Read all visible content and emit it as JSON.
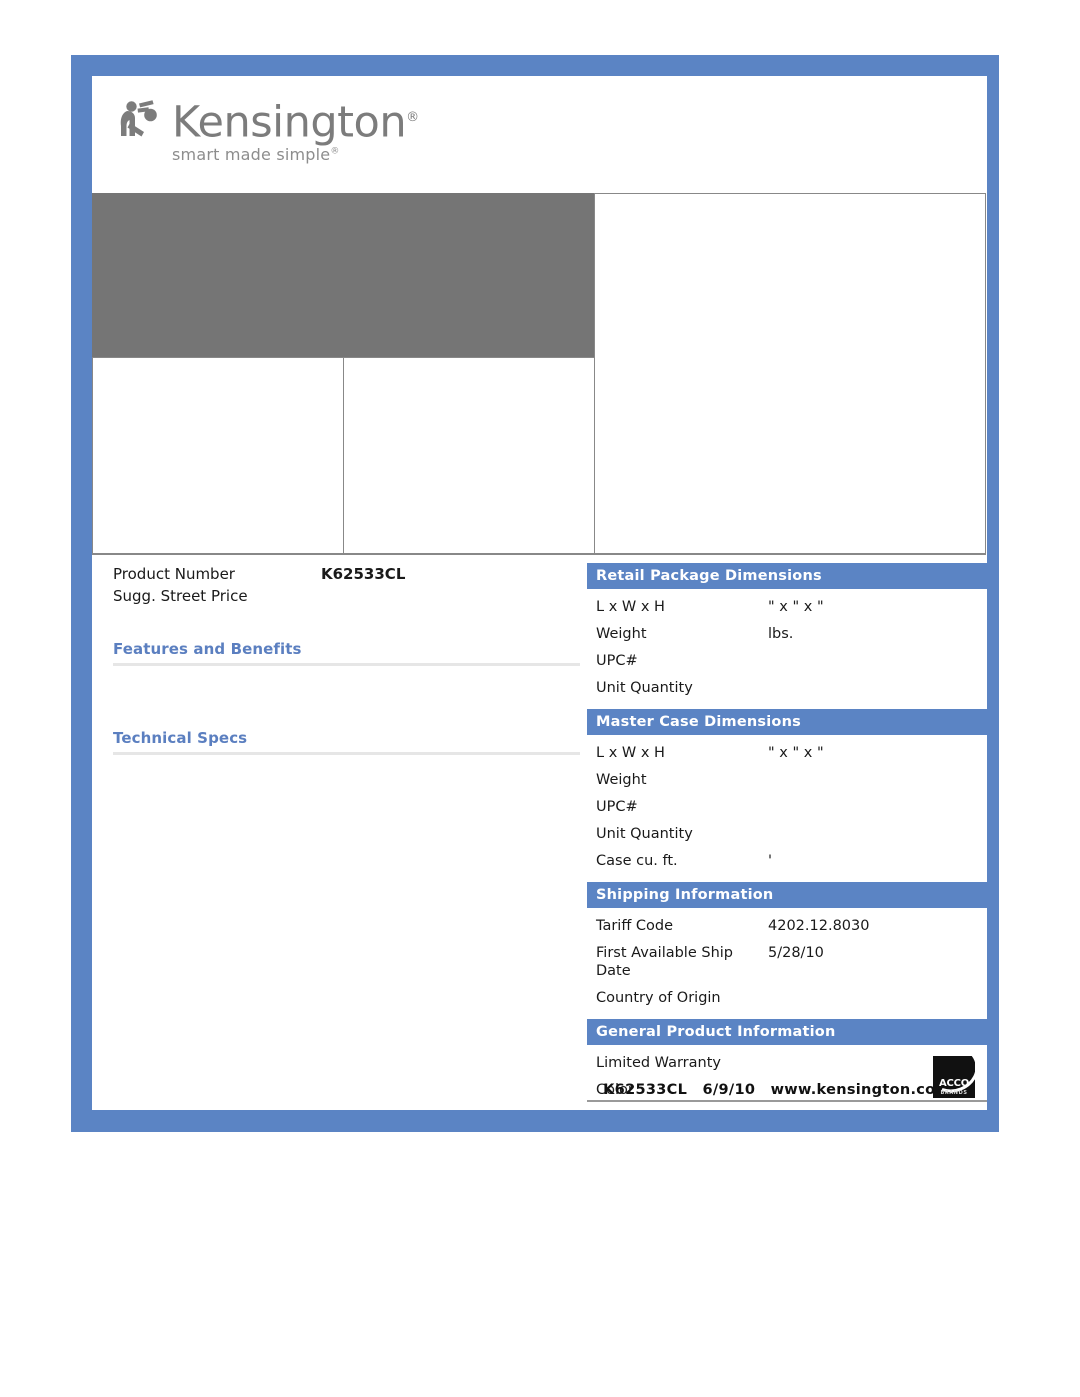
{
  "brand": {
    "name": "Kensington",
    "registered": "®",
    "tagline": "smart made simple",
    "tagline_mark": "®",
    "logo_icon": "kensington-figure-icon"
  },
  "product": {
    "number_label": "Product Number",
    "number_value": "K62533CL",
    "price_label": "Sugg. Street Price",
    "price_value": ""
  },
  "left_sections": {
    "features_title": "Features and Benefits",
    "features_body": "",
    "specs_title": "Technical Specs",
    "specs_body": ""
  },
  "retail_package": {
    "title": "Retail Package Dimensions",
    "rows": [
      {
        "label": "L x W x H",
        "value": "\" x \" x \""
      },
      {
        "label": "Weight",
        "value": "lbs."
      },
      {
        "label": "UPC#",
        "value": ""
      },
      {
        "label": "Unit Quantity",
        "value": ""
      }
    ]
  },
  "master_case": {
    "title": "Master Case Dimensions",
    "rows": [
      {
        "label": "L x W x H",
        "value": "\" x \" x \""
      },
      {
        "label": "Weight",
        "value": ""
      },
      {
        "label": "UPC#",
        "value": ""
      },
      {
        "label": "Unit Quantity",
        "value": ""
      },
      {
        "label": "Case cu. ft.",
        "value": "'"
      }
    ]
  },
  "shipping": {
    "title": "Shipping Information",
    "rows": [
      {
        "label": "Tariff Code",
        "value": "4202.12.8030"
      },
      {
        "label": "First Available Ship Date",
        "value": "5/28/10"
      },
      {
        "label": "Country of Origin",
        "value": ""
      }
    ]
  },
  "general": {
    "title": "General Product Information",
    "rows": [
      {
        "label": "Limited Warranty",
        "value": ""
      },
      {
        "label": "Color",
        "value": ""
      }
    ]
  },
  "footer": {
    "sku": "K62533CL",
    "date": "6/9/10",
    "website": "www.kensington.com",
    "acco_name": "ACCO",
    "acco_sub": "BRANDS"
  },
  "colors": {
    "frame_blue": "#5b84c4",
    "header_blue": "#5b84c4",
    "left_header_blue": "#5b7fc0",
    "image_placeholder_gray": "#757575"
  }
}
